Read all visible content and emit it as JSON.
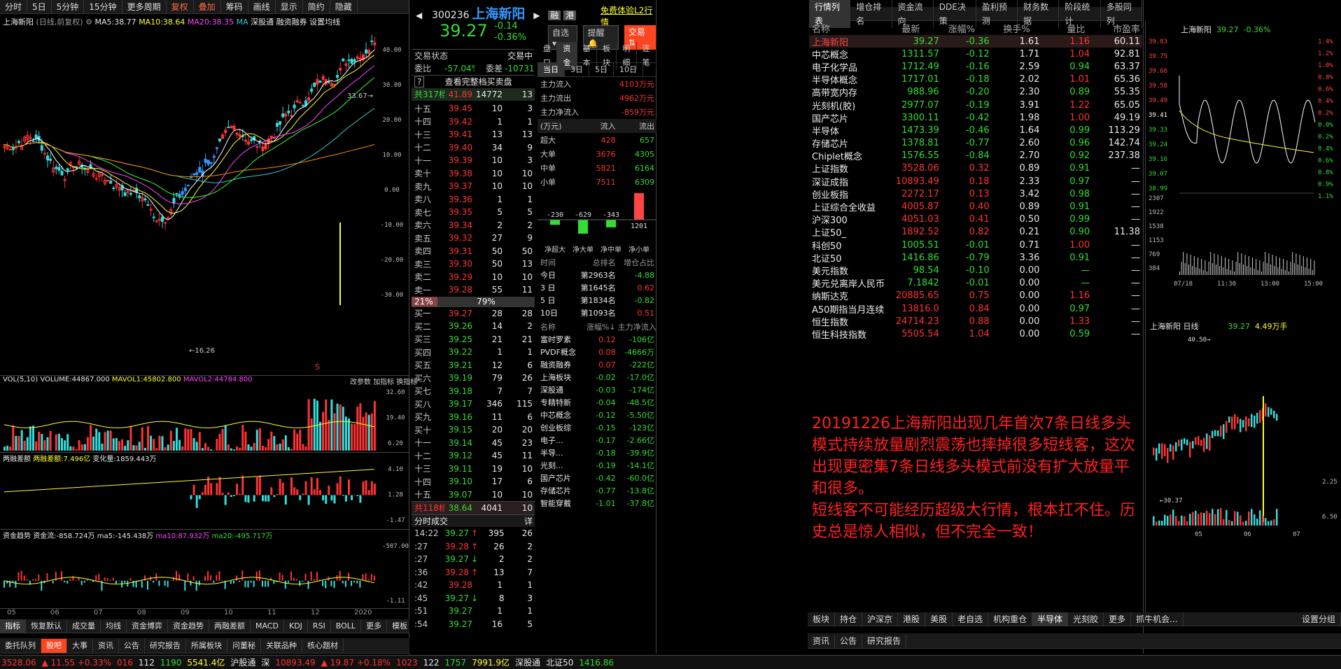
{
  "left_toolbar": [
    "分时",
    "5日",
    "5分钟",
    "15分钟",
    "更多周期",
    "复权",
    "叠加",
    "筹码",
    "画线",
    "显示",
    "简约",
    "隐藏"
  ],
  "chart_header": {
    "title": "上海新阳",
    "sub": "(日线,前复权)",
    "ma5": "MA5:38.77",
    "ma10": "MA10:38.64",
    "ma20": "MA20:38.35",
    "ma_more": "MA",
    "tags": [
      "深股通",
      "融资融券"
    ],
    "setting": "设置均线"
  },
  "price_axis": [
    "40.00",
    "30.00",
    "20.00",
    "10.00",
    "0.00",
    "-10.00",
    "-20.00",
    "-30.00"
  ],
  "price_marks": {
    "high": "33.67",
    "low": "16.26",
    "s": "S"
  },
  "vol_panel": {
    "name": "VOL(5,10)",
    "volume": "VOLUME:44867.000",
    "mavol1": "MAVOL1:45802.800",
    "mavol2": "MAVOL2:44784.800",
    "axis": [
      "32.60",
      "19.40",
      "6.20"
    ]
  },
  "margin_panel": {
    "name": "两融差额",
    "val": "两融差额:7.496亿",
    "chg": "变化量:1859.443万",
    "axis": [
      "4.10",
      "1.28",
      "-1.47"
    ]
  },
  "fund_panel": {
    "name": "资金趋势",
    "flow": "资金流:-858.724万",
    "ma5": "ma5:-145.438万",
    "ma10": "ma10:87.932万",
    "ma20": "ma20:-495.717万",
    "axis": [
      "-507.00",
      "-1.11"
    ]
  },
  "panel_links": [
    "改参数",
    "加指标",
    "换指标"
  ],
  "x_axis": [
    "05",
    "06",
    "07",
    "08",
    "09",
    "10",
    "11",
    "12",
    "2020"
  ],
  "indicator_tabs": [
    "指标",
    "恢复默认",
    "成交量",
    "均线",
    "资金博弈",
    "资金趋势",
    "两融差额",
    "MACD",
    "KDJ",
    "RSI",
    "BOLL",
    "更多",
    "模板"
  ],
  "bottom_tabs": [
    "委托队列",
    "股吧",
    "大事",
    "资讯",
    "公告",
    "研究报告",
    "所属板块",
    "问董秘",
    "关联品种",
    "核心题材"
  ],
  "status": {
    "index1": "3528.06",
    "chg1": "▲ 11.55 +0.33%",
    "n1": "016",
    "n2": "112",
    "n3": "1190",
    "amt1": "5541.4亿",
    "hgt": "沪股通",
    "sz": "深",
    "szv": "10893.49",
    "szc": "▲ 19.87 +0.18%",
    "n4": "1023",
    "n5": "122",
    "n6": "1757",
    "amt2": "7991.9亿",
    "sgt": "深股通",
    "bz": "北证50",
    "bzv": "1416.86"
  },
  "quote": {
    "code": "300236",
    "name": "上海新阳",
    "price": "39.27",
    "chg": "-0.14",
    "pct": "-0.36%",
    "badges": [
      "融",
      "港"
    ],
    "l2": "免费体验L2行情",
    "btn_zx": "自选",
    "btn_tx": "提醒",
    "btn_jy": "交易"
  },
  "order": {
    "state": "交易状态",
    "trade": "交易中",
    "wb": "委比",
    "wb_v": "-57.04%",
    "wc": "委差",
    "wc_v": "-10731",
    "full": "查看完整档买卖盘",
    "total_ask": "共317档",
    "ta_p": "41.89",
    "ta_v": "14772",
    "ta_n": "13",
    "total_bid": "共118档",
    "tb_p": "38.64",
    "tb_v": "4041",
    "tb_n": "10",
    "ratio_l": "21%",
    "ratio_r": "79%"
  },
  "asks": [
    [
      "十五",
      "39.45",
      "10",
      "3"
    ],
    [
      "十四",
      "39.42",
      "1",
      "1"
    ],
    [
      "十三",
      "39.41",
      "13",
      "13"
    ],
    [
      "十二",
      "39.40",
      "34",
      "9"
    ],
    [
      "十一",
      "39.39",
      "10",
      "3"
    ],
    [
      "卖十",
      "39.38",
      "10",
      "10"
    ],
    [
      "卖九",
      "39.37",
      "10",
      "10"
    ],
    [
      "卖八",
      "39.36",
      "1",
      "1"
    ],
    [
      "卖七",
      "39.35",
      "5",
      "5"
    ],
    [
      "卖六",
      "39.34",
      "2",
      "2"
    ],
    [
      "卖五",
      "39.32",
      "27",
      "9"
    ],
    [
      "卖四",
      "39.31",
      "50",
      "50"
    ],
    [
      "卖三",
      "39.30",
      "50",
      "13"
    ],
    [
      "卖二",
      "39.29",
      "10",
      "10"
    ],
    [
      "卖一",
      "39.28",
      "55",
      "11"
    ]
  ],
  "bids": [
    [
      "买一",
      "39.27",
      "28",
      "28"
    ],
    [
      "买二",
      "39.26",
      "14",
      "2"
    ],
    [
      "买三",
      "39.25",
      "21",
      "21"
    ],
    [
      "买四",
      "39.22",
      "1",
      "1"
    ],
    [
      "买五",
      "39.21",
      "12",
      "6"
    ],
    [
      "买六",
      "39.19",
      "79",
      "26"
    ],
    [
      "买七",
      "39.18",
      "7",
      "7"
    ],
    [
      "买八",
      "39.17",
      "346",
      "115"
    ],
    [
      "买九",
      "39.16",
      "11",
      "6"
    ],
    [
      "买十",
      "39.15",
      "20",
      "20"
    ],
    [
      "十一",
      "39.14",
      "45",
      "23"
    ],
    [
      "十二",
      "39.12",
      "45",
      "11"
    ],
    [
      "十三",
      "39.11",
      "19",
      "10"
    ],
    [
      "十四",
      "39.10",
      "17",
      "6"
    ],
    [
      "十五",
      "39.07",
      "10",
      "10"
    ]
  ],
  "trades_title": "分时成交",
  "trades_more": "详",
  "trades": [
    [
      "14:22",
      "39.27",
      "↑",
      "395",
      "26"
    ],
    [
      ":27",
      "39.28",
      "↑",
      "26",
      "2"
    ],
    [
      ":27",
      "39.27",
      "↓",
      "2",
      "2"
    ],
    [
      ":36",
      "39.28",
      "↑",
      "13",
      "7"
    ],
    [
      ":42",
      "39.28",
      "",
      "1",
      "1"
    ],
    [
      ":45",
      "39.27",
      "↓",
      "8",
      "3"
    ],
    [
      ":51",
      "39.27",
      "",
      "1",
      "1"
    ],
    [
      ":54",
      "39.27",
      "",
      "16",
      "5"
    ]
  ],
  "fund_tabs": [
    "盘口",
    "资金",
    "基本",
    "板块",
    "明细",
    "逐笔"
  ],
  "period_tabs": [
    "当日",
    "3日",
    "5日",
    "10日"
  ],
  "main_flow": [
    [
      "主力流入",
      "4103万元"
    ],
    [
      "主力流出",
      "4962万元"
    ],
    [
      "主力净流入",
      "-859万元"
    ]
  ],
  "flow_table": {
    "unit": "(万元)",
    "in": "流入",
    "out": "流出",
    "rows": [
      [
        "超大",
        "428",
        "657"
      ],
      [
        "大单",
        "3676",
        "4305"
      ],
      [
        "中单",
        "5821",
        "6164"
      ],
      [
        "小单",
        "7511",
        "6309"
      ]
    ]
  },
  "net_bars": {
    "values": [
      -230,
      -629,
      -343,
      1201
    ],
    "labels": [
      "净超大",
      "净大单",
      "净中单",
      "净小单"
    ]
  },
  "rank": {
    "h": [
      "时间",
      "总排名",
      "增仓占比"
    ],
    "rows": [
      [
        "今日",
        "第2963名",
        "-4.88"
      ],
      [
        "3 日",
        "第1645名",
        "0.62"
      ],
      [
        "5 日",
        "第1834名",
        "-0.82"
      ],
      [
        "10日",
        "第1093名",
        "0.51"
      ]
    ]
  },
  "sectors": {
    "h": [
      "名称",
      "涨幅%↓",
      "主力净流入"
    ],
    "rows": [
      [
        "富时罗素",
        "0.12",
        "-106亿"
      ],
      [
        "PVDF概念",
        "0.08",
        "-4666万"
      ],
      [
        "融资融券",
        "0.07",
        "-222亿"
      ],
      [
        "上海板块",
        "-0.02",
        "-17.0亿"
      ],
      [
        "深股通",
        "-0.03",
        "-174亿"
      ],
      [
        "专精特新",
        "-0.04",
        "-48.5亿"
      ],
      [
        "中芯概念",
        "-0.12",
        "-5.50亿"
      ],
      [
        "创业板综",
        "-0.15",
        "-123亿"
      ],
      [
        "电子...",
        "-0.17",
        "-2.66亿"
      ],
      [
        "半导...",
        "-0.18",
        "-39.9亿"
      ],
      [
        "光刻...",
        "-0.19",
        "-14.1亿"
      ],
      [
        "国产芯片",
        "-0.42",
        "-60.0亿"
      ],
      [
        "存储芯片",
        "-0.77",
        "-13.8亿"
      ],
      [
        "智能穿戴",
        "-1.01",
        "-37.8亿"
      ]
    ]
  },
  "market_tabs": [
    "行情列表",
    "增仓排名",
    "资金流向",
    "DDE决策",
    "盈利预测",
    "财务数据",
    "阶段统计",
    "多股同列"
  ],
  "market_head": [
    "名称",
    "最新",
    "涨幅%",
    "换手%",
    "量比",
    "市盈率"
  ],
  "market_rows": [
    [
      "上海新阳",
      "39.27",
      "-0.36",
      "1.61",
      "1.16",
      "60.11"
    ],
    [
      "中芯概念",
      "1311.57",
      "-0.12",
      "1.71",
      "1.04",
      "92.81"
    ],
    [
      "电子化学品",
      "1712.49",
      "-0.16",
      "2.59",
      "0.94",
      "63.37"
    ],
    [
      "半导体概念",
      "1717.01",
      "-0.18",
      "2.02",
      "1.01",
      "65.36"
    ],
    [
      "高带宽内存",
      "988.96",
      "-0.20",
      "2.30",
      "0.89",
      "55.35"
    ],
    [
      "光刻机(胶)",
      "2977.07",
      "-0.19",
      "3.91",
      "1.22",
      "65.05"
    ],
    [
      "国产芯片",
      "3300.11",
      "-0.42",
      "1.98",
      "1.00",
      "49.19"
    ],
    [
      "半导体",
      "1473.39",
      "-0.46",
      "1.64",
      "0.99",
      "113.29"
    ],
    [
      "存储芯片",
      "1378.81",
      "-0.77",
      "2.60",
      "0.96",
      "142.74"
    ],
    [
      "Chiplet概念",
      "1576.55",
      "-0.84",
      "2.70",
      "0.92",
      "237.38"
    ],
    [
      "上证指数",
      "3528.06",
      "0.32",
      "0.89",
      "0.91",
      "—"
    ],
    [
      "深证成指",
      "10893.49",
      "0.18",
      "2.33",
      "0.97",
      "—"
    ],
    [
      "创业板指",
      "2272.17",
      "0.13",
      "3.42",
      "0.98",
      "—"
    ],
    [
      "上证综合全收益",
      "4005.87",
      "0.40",
      "0.89",
      "0.91",
      "—"
    ],
    [
      "沪深300",
      "4051.03",
      "0.41",
      "0.50",
      "0.99",
      "—"
    ],
    [
      "上证50_",
      "1892.52",
      "0.82",
      "0.21",
      "0.90",
      "11.38"
    ],
    [
      "科创50",
      "1005.51",
      "-0.01",
      "0.71",
      "1.00",
      "—"
    ],
    [
      "北证50",
      "1416.86",
      "-0.79",
      "3.36",
      "0.91",
      "—"
    ],
    [
      "美元指数",
      "98.54",
      "-0.10",
      "0.00",
      "—",
      "—"
    ],
    [
      "美元兑离岸人民币",
      "7.1842",
      "-0.01",
      "0.00",
      "—",
      "—"
    ],
    [
      "纳斯达克",
      "20885.65",
      "0.75",
      "0.00",
      "1.16",
      "—"
    ],
    [
      "A50期指当月连续",
      "13816.0",
      "0.84",
      "0.00",
      "0.97",
      "—"
    ],
    [
      "恒生指数",
      "24714.23",
      "0.88",
      "0.00",
      "1.33",
      "—"
    ],
    [
      "恒生科技指数",
      "5505.54",
      "1.04",
      "0.00",
      "0.59",
      "—"
    ]
  ],
  "note": "20191226上海新阳出现几年首次7条日线多头模式持续放量剧烈震荡也摔掉很多短线客，这次出现更密集7条日线多头模式前没有扩大放量平和很多。\n短线客不可能经历超级大行情，根本扛不住。历史总是惊人相似，但不完全一致！",
  "sector_tabs": [
    "板块",
    "持仓",
    "沪深京",
    "港股",
    "美股",
    "老自选",
    "机构重仓",
    "半导体",
    "光刻胶",
    "更多",
    "抓牛机会..."
  ],
  "sector_setting": "设置分组",
  "news_tabs": [
    "资讯",
    "公告",
    "研究报告"
  ],
  "mini": {
    "name": "上海新阳",
    "price": "39.27",
    "pct": "-0.36%",
    "left_axis": [
      "39.83",
      "39.75",
      "39.66",
      "39.58",
      "39.49",
      "39.41",
      "39.33",
      "39.24",
      "39.16",
      "39.07",
      "38.99"
    ],
    "right_axis": [
      "1.4%",
      "1.2%",
      "1.0%",
      "0.8%",
      "0.6%",
      "0.4%",
      "0.2%",
      "0.0%",
      "0.2%",
      "0.4%",
      "0.6%",
      "0.8%",
      "0.9%",
      "1.1%"
    ],
    "vol_axis": [
      "2307",
      "1922",
      "1538",
      "1153",
      "769",
      "384"
    ],
    "times": [
      "07/18",
      "11:30",
      "13:00",
      "15:00"
    ]
  },
  "day_mini": {
    "name": "上海新阳",
    "period": "日线",
    "price": "39.27",
    "mult": "4.49万手",
    "high": "40.50",
    "low": "30.37",
    "axis": [
      "2.25",
      "6.50"
    ],
    "x": [
      "05",
      "06",
      "07"
    ]
  }
}
